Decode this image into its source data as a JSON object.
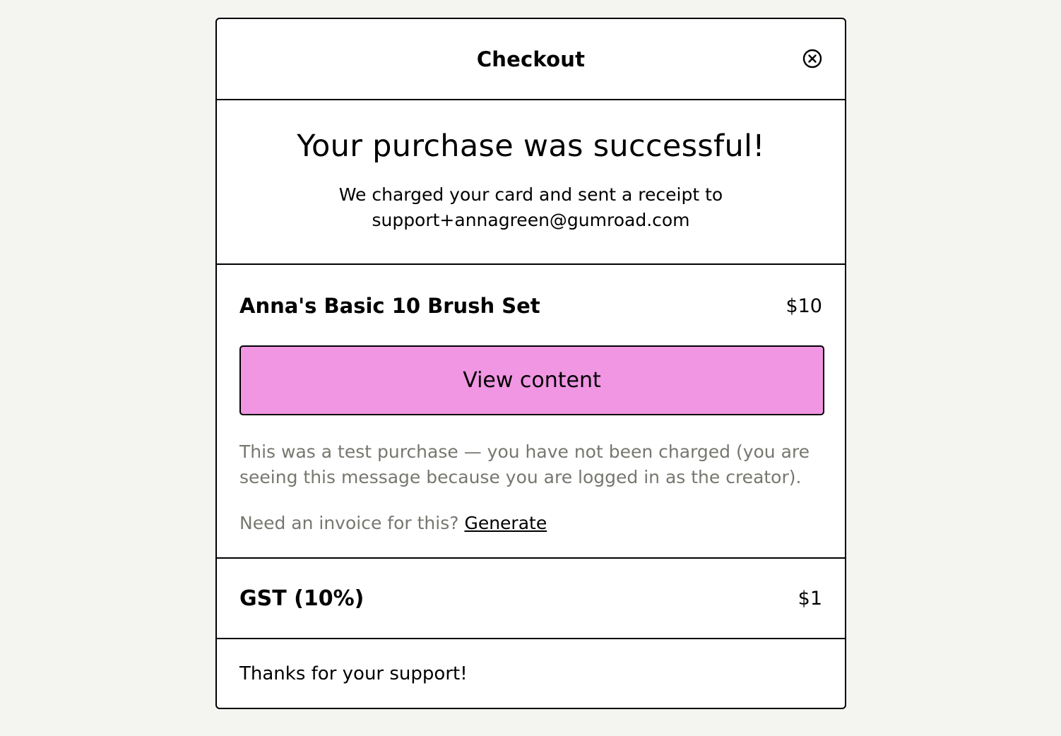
{
  "header": {
    "title": "Checkout",
    "close_icon": "close-circle-icon"
  },
  "success": {
    "title": "Your purchase was successful!",
    "message": "We charged your card and sent a receipt to support+annagreen@gumroad.com"
  },
  "product": {
    "name": "Anna's Basic 10 Brush Set",
    "price": "$10",
    "view_button_label": "View content",
    "test_note": "This was a test purchase — you have not been charged (you are seeing this message because you are logged in as the creator).",
    "invoice_prompt": "Need an invoice for this?",
    "invoice_link": "Generate"
  },
  "tax": {
    "label": "GST (10%)",
    "amount": "$1"
  },
  "footer": {
    "thanks": "Thanks for your support!"
  },
  "colors": {
    "page_background": "#f4f4f0",
    "button_pink": "#f096e3",
    "muted_text": "#777770"
  }
}
